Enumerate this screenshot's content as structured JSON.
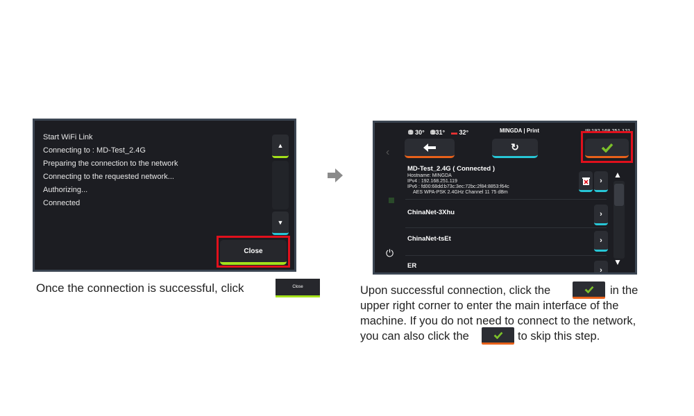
{
  "left_screen": {
    "log_lines": [
      "Start WiFi Link",
      "Connecting to : MD-Test_2.4G",
      "Preparing the connection to the network",
      "Connecting to the requested network...",
      "Authorizing...",
      "Connected"
    ],
    "close_label": "Close"
  },
  "right_screen": {
    "temps": {
      "nozzle": "30°",
      "bed": "31°",
      "chamber": "32°"
    },
    "title": "MINGDA | Print",
    "ip": "IP:192.168.251.121",
    "connected_network": {
      "name": "MD-Test_2.4G ( Connected )",
      "hostname": "Hostname: MINGDA",
      "ipv4": "IPv4 : 192.168.251.119",
      "ipv6": "IPv6 : fd00:68dd:b73c:3ec:72bc:2f84:8853:f64c",
      "details": "AES WPA-PSK  2.4GHz Channel 11 75 dBm"
    },
    "networks": [
      "ChinaNet-3Xhu",
      "ChinaNet-tsEt",
      "ER"
    ]
  },
  "captions": {
    "left": "Once the connection is successful, click",
    "inline_close": "Close",
    "right_line1_a": "Upon successful connection, click the",
    "right_line1_b": "in the",
    "right_line2": "upper right corner to enter the main interface of the",
    "right_line3": "machine. If you do not need to connect to the network,",
    "right_line4_a": "you can also click the",
    "right_line4_b": "to skip this step."
  },
  "colors": {
    "accent_green": "#a4e11a",
    "accent_cyan": "#27c6d6",
    "accent_orange": "#e8611a",
    "highlight_red": "#e0101c"
  }
}
